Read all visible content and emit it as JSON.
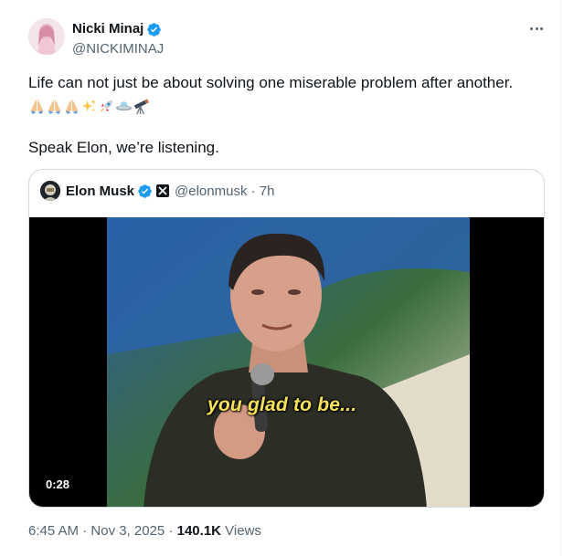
{
  "tweet": {
    "author_name": "Nicki Minaj",
    "author_handle": "@NICKIMINAJ",
    "text_line1": "Life can not just be about solving one miserable problem after another.",
    "emojis": [
      "folded-hands",
      "folded-hands",
      "folded-hands",
      "sparkles",
      "rocket",
      "flying-saucer",
      "telescope"
    ],
    "text_line2": "Speak Elon, we’re listening.",
    "time": "6:45 AM",
    "date": "Nov 3, 2025",
    "views_count": "140.1K",
    "views_label": "Views"
  },
  "quote": {
    "author_name": "Elon Musk",
    "author_handle": "@elonmusk",
    "age": "7h",
    "video_caption": "you glad to be...",
    "video_duration": "0:28"
  },
  "colors": {
    "verified_blue": "#1d9bf0",
    "secondary_text": "#536471",
    "border": "#cfd9de",
    "caption_yellow": "#f5e15a"
  }
}
